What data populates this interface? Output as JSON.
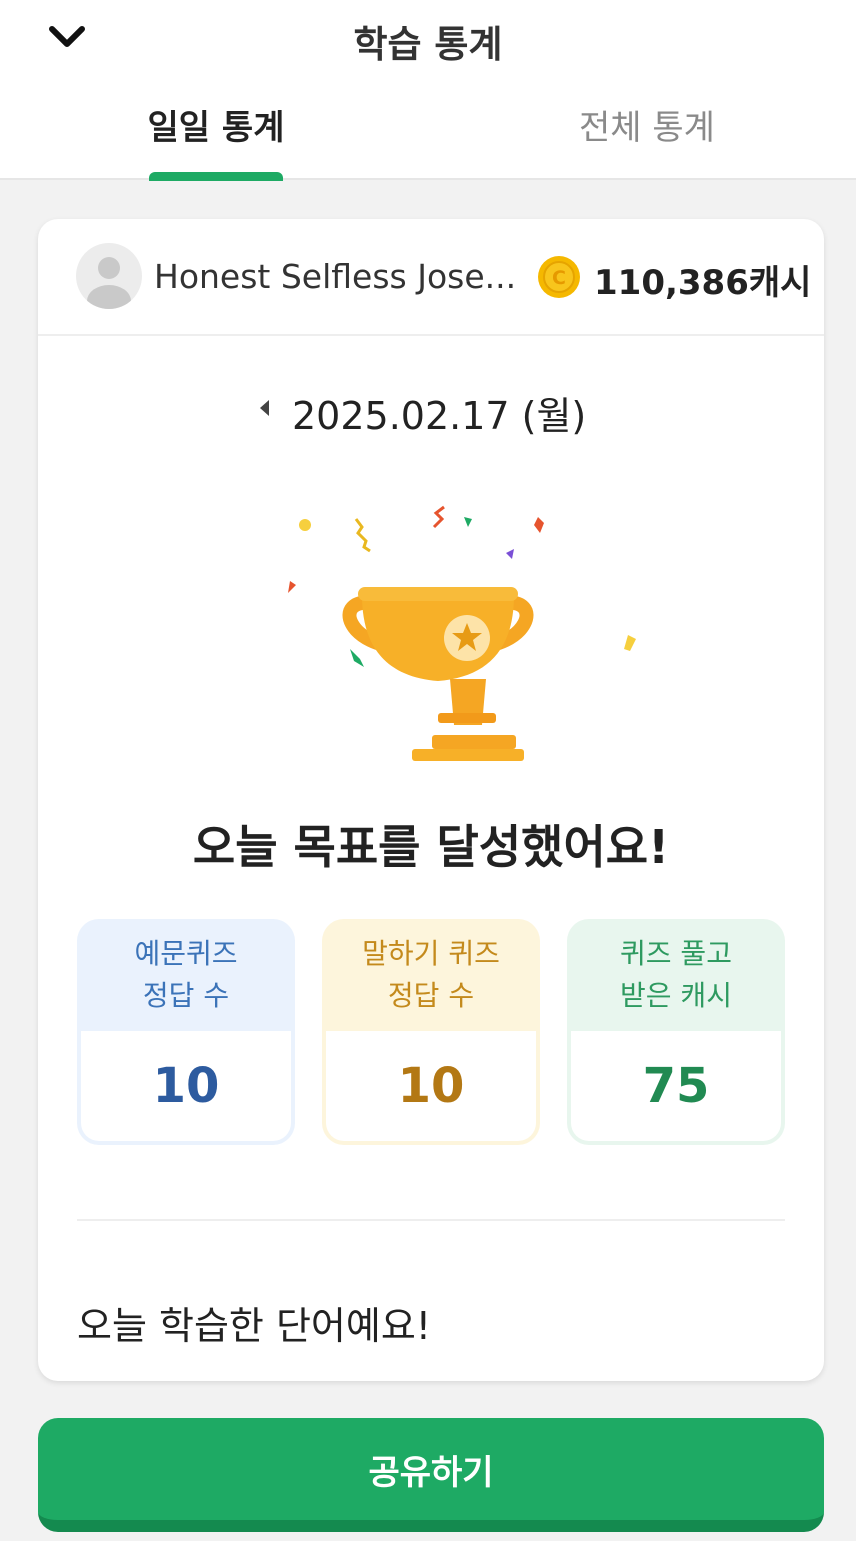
{
  "header": {
    "title": "학습 통계",
    "back_icon": "chevron-down-icon"
  },
  "tabs": [
    {
      "label": "일일 통계",
      "selected": true
    },
    {
      "label": "전체 통계",
      "selected": false
    }
  ],
  "accent_color": "#1eaa64",
  "profile": {
    "name": "Honest Selfless Jose...",
    "cash": "110,386캐시",
    "coin_icon": "coin-icon",
    "avatar_icon": "default-avatar-icon"
  },
  "date": {
    "text": "2025.02.17 (월)",
    "prev_icon": "caret-left-icon"
  },
  "achievement": {
    "icon": "trophy-icon",
    "message": "오늘 목표를 달성했어요!"
  },
  "stats": [
    {
      "line1": "예문퀴즈",
      "line2": "정답 수",
      "value": "10",
      "color": "#2d5b9f"
    },
    {
      "line1": "말하기 퀴즈",
      "line2": "정답 수",
      "value": "10",
      "color": "#b37814"
    },
    {
      "line1": "퀴즈 풀고",
      "line2": "받은 캐시",
      "value": "75",
      "color": "#218a52"
    }
  ],
  "words_section": {
    "heading": "오늘 학습한 단어예요!"
  },
  "share_button": {
    "label": "공유하기"
  }
}
